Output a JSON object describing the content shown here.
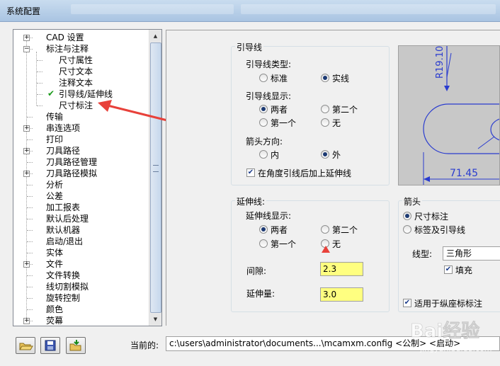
{
  "window": {
    "title": "系统配置"
  },
  "tree": {
    "items": [
      {
        "label": "CAD 设置",
        "expander": "+"
      },
      {
        "label": "标注与注释",
        "expander": "-"
      },
      {
        "label": "尺寸属性",
        "expander": ""
      },
      {
        "label": "尺寸文本",
        "expander": ""
      },
      {
        "label": "注释文本",
        "expander": ""
      },
      {
        "label": "引导线/延伸线",
        "expander": "",
        "checked": true
      },
      {
        "label": "尺寸标注",
        "expander": ""
      },
      {
        "label": "传输",
        "expander": ""
      },
      {
        "label": "串连选项",
        "expander": "+"
      },
      {
        "label": "打印",
        "expander": ""
      },
      {
        "label": "刀具路径",
        "expander": "+"
      },
      {
        "label": "刀具路径管理",
        "expander": ""
      },
      {
        "label": "刀具路径模拟",
        "expander": "+"
      },
      {
        "label": "分析",
        "expander": ""
      },
      {
        "label": "公差",
        "expander": ""
      },
      {
        "label": "加工报表",
        "expander": ""
      },
      {
        "label": "默认后处理",
        "expander": ""
      },
      {
        "label": "默认机器",
        "expander": ""
      },
      {
        "label": "启动/退出",
        "expander": ""
      },
      {
        "label": "实体",
        "expander": ""
      },
      {
        "label": "文件",
        "expander": "+"
      },
      {
        "label": "文件转换",
        "expander": ""
      },
      {
        "label": "线切割模拟",
        "expander": ""
      },
      {
        "label": "旋转控制",
        "expander": ""
      },
      {
        "label": "颜色",
        "expander": ""
      },
      {
        "label": "荧幕",
        "expander": "+"
      }
    ]
  },
  "leader": {
    "group_title": "引导线",
    "type_label": "引导线类型:",
    "type_options": [
      "标准",
      "实线"
    ],
    "type_selected": 1,
    "display_label": "引导线显示:",
    "display_options": [
      "两者",
      "第二个",
      "第一个",
      "无"
    ],
    "display_selected": 0,
    "arrow_dir_label": "箭头方向:",
    "arrow_dir_options": [
      "内",
      "外"
    ],
    "arrow_dir_selected": 1,
    "extend_check_label": "在角度引线后加上延伸线",
    "extend_checked": true
  },
  "extension": {
    "group_title": "延伸线:",
    "display_label": "延伸线显示:",
    "display_options": [
      "两者",
      "第二个",
      "第一个",
      "无"
    ],
    "display_selected": 0,
    "gap_label": "间隙:",
    "gap_value": "2.3",
    "extend_label": "延伸量:",
    "extend_value": "3.0"
  },
  "arrow": {
    "group_title": "箭头",
    "options": [
      "尺寸标注",
      "标签及引导线"
    ],
    "selected": 0,
    "linetype_label": "线型:",
    "linetype_value": "三角形",
    "fill_label": "填充",
    "fill_checked": true,
    "ordinate_label": "适用于纵座标标注",
    "ordinate_checked": true
  },
  "preview": {
    "radius_text": "R19.10",
    "length_text": "71.45"
  },
  "bottom": {
    "current_label": "当前的:",
    "current_path": "c:\\users\\administrator\\documents...\\mcamxm.config <公制> <启动>"
  },
  "icons": {
    "open": "folder-open-icon",
    "save": "save-icon",
    "merge": "folder-merge-icon"
  },
  "watermark": {
    "text": "Bai经验",
    "sub": "jingyan.baidu.com"
  },
  "colors": {
    "field_bg": "#ffff80",
    "arrow_annotation": "#e8413a",
    "check": "#1a9a1a"
  }
}
